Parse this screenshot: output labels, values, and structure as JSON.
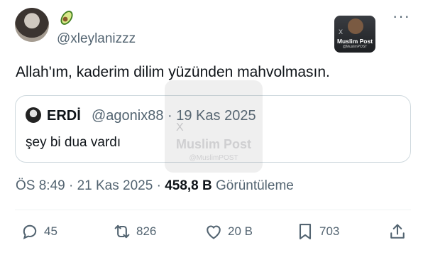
{
  "tweet": {
    "author_emoji": "avocado",
    "handle": "@xleylanizzz",
    "text": "Allah'ım, kaderim dilim yüzünden mahvolmasın.",
    "timestamp": "ÖS 8:49 · 21 Kas 2025 · ",
    "views_count": "458,8 B",
    "views_label": "Görüntüleme"
  },
  "quote": {
    "name": "ERDİ",
    "handle": "@agonix88 · 19 Kas 2025",
    "text": "şey bi dua vardı"
  },
  "watermark": {
    "title": "Muslim Post",
    "sub": "@MuslimPOST",
    "x": "X"
  },
  "actions": {
    "reply_count": "45",
    "retweet_count": "826",
    "like_count": "20 B",
    "bookmark_count": "703"
  },
  "icons": [
    "avocado-icon",
    "more-icon",
    "reply-icon",
    "retweet-icon",
    "like-icon",
    "bookmark-icon",
    "share-icon"
  ],
  "colors": {
    "text": "#0f1419",
    "muted": "#536471",
    "border": "#cfd9de"
  }
}
